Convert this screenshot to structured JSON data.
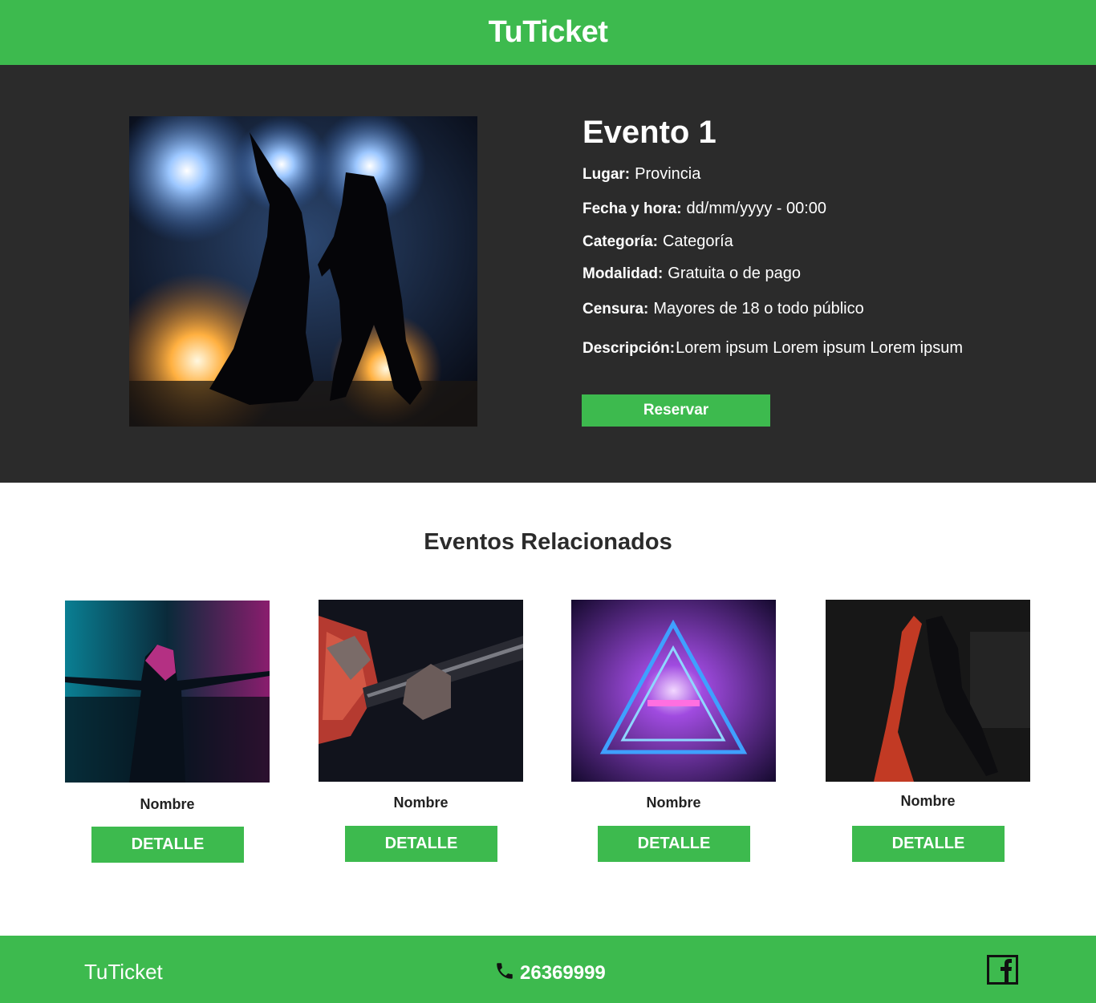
{
  "header": {
    "brand": "TuTicket"
  },
  "event": {
    "title": "Evento 1",
    "fields": [
      {
        "label": "Lugar:",
        "value": "Provincia"
      },
      {
        "label": "Fecha y hora:",
        "value": "dd/mm/yyyy - 00:00"
      },
      {
        "label": "Categoría:",
        "value": "Categoría"
      },
      {
        "label": "Modalidad:",
        "value": "Gratuita o de pago"
      },
      {
        "label": "Censura:",
        "value": "Mayores de 18 o todo público"
      },
      {
        "label": "Descripción:",
        "value": "Lorem ipsum Lorem ipsum Lorem ipsum"
      }
    ],
    "reserve_label": "Reservar"
  },
  "related": {
    "title": "Eventos Relacionados",
    "cards": [
      {
        "name": "Nombre",
        "button": "DETALLE"
      },
      {
        "name": "Nombre",
        "button": "DETALLE"
      },
      {
        "name": "Nombre",
        "button": "DETALLE"
      },
      {
        "name": "Nombre",
        "button": "DETALLE"
      }
    ]
  },
  "footer": {
    "brand": "TuTicket",
    "phone": "26369999"
  },
  "icons": {
    "phone": "phone-icon",
    "facebook": "facebook-icon"
  },
  "colors": {
    "accent": "#3dba4e",
    "dark": "#2b2b2b"
  }
}
